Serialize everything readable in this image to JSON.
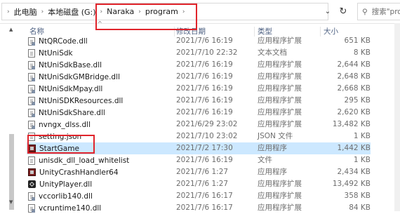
{
  "addressbar": {
    "breadcrumbs": [
      "此电脑",
      "本地磁盘 (G:)",
      "Naraka",
      "program"
    ],
    "search_placeholder": "搜索\"pro"
  },
  "columns": {
    "name": "名称",
    "date": "修改日期",
    "type": "类型",
    "size": "大小"
  },
  "files": [
    {
      "name": "NtQRCode.dll",
      "date": "2021/7/6 16:19",
      "type": "应用程序扩展",
      "size": "651 KB",
      "icon": "dll-icon"
    },
    {
      "name": "NtUniSdk",
      "date": "2021/7/10 22:32",
      "type": "文本文档",
      "size": "8 KB",
      "icon": "text-file-icon"
    },
    {
      "name": "NtUniSdkBase.dll",
      "date": "2021/7/6 16:19",
      "type": "应用程序扩展",
      "size": "2,644 KB",
      "icon": "dll-icon"
    },
    {
      "name": "NtUniSdkGMBridge.dll",
      "date": "2021/7/6 16:19",
      "type": "应用程序扩展",
      "size": "2,648 KB",
      "icon": "dll-icon"
    },
    {
      "name": "NtUniSdkMpay.dll",
      "date": "2021/7/6 16:19",
      "type": "应用程序扩展",
      "size": "2,668 KB",
      "icon": "dll-icon"
    },
    {
      "name": "NtUniSDKResources.dll",
      "date": "2021/7/6 16:19",
      "type": "应用程序扩展",
      "size": "295 KB",
      "icon": "dll-icon"
    },
    {
      "name": "NtUniSdkShare.dll",
      "date": "2021/7/6 16:19",
      "type": "应用程序扩展",
      "size": "2,620 KB",
      "icon": "dll-icon"
    },
    {
      "name": "nvngx_dlss.dll",
      "date": "2021/6/29 23:02",
      "type": "应用程序扩展",
      "size": "13,482 KB",
      "icon": "dll-icon"
    },
    {
      "name": "setting.json",
      "date": "2021/7/10 23:02",
      "type": "JSON 文件",
      "size": "1 KB",
      "icon": "json-file-icon"
    },
    {
      "name": "StartGame",
      "date": "2021/7/2 17:30",
      "type": "应用程序",
      "size": "1,442 KB",
      "icon": "app-icon",
      "selected": true
    },
    {
      "name": "unisdk_dll_load_whitelist",
      "date": "2021/7/6 16:19",
      "type": "文件",
      "size": "1 KB",
      "icon": "file-icon"
    },
    {
      "name": "UnityCrashHandler64",
      "date": "2021/7/6 1:27",
      "type": "应用程序",
      "size": "2,434 KB",
      "icon": "app-icon"
    },
    {
      "name": "UnityPlayer.dll",
      "date": "2021/7/6 1:27",
      "type": "应用程序扩展",
      "size": "13,492 KB",
      "icon": "unity-icon"
    },
    {
      "name": "vccorlib140.dll",
      "date": "2021/7/6 16:17",
      "type": "应用程序扩展",
      "size": "358 KB",
      "icon": "dll-icon"
    },
    {
      "name": "vcruntime140.dll",
      "date": "2021/7/6 16:17",
      "type": "应用程序扩展",
      "size": "84 KB",
      "icon": "dll-icon"
    }
  ],
  "colors": {
    "selection": "#cce8ff",
    "highlight_box": "#e0242b",
    "header_text": "#4d6082"
  }
}
